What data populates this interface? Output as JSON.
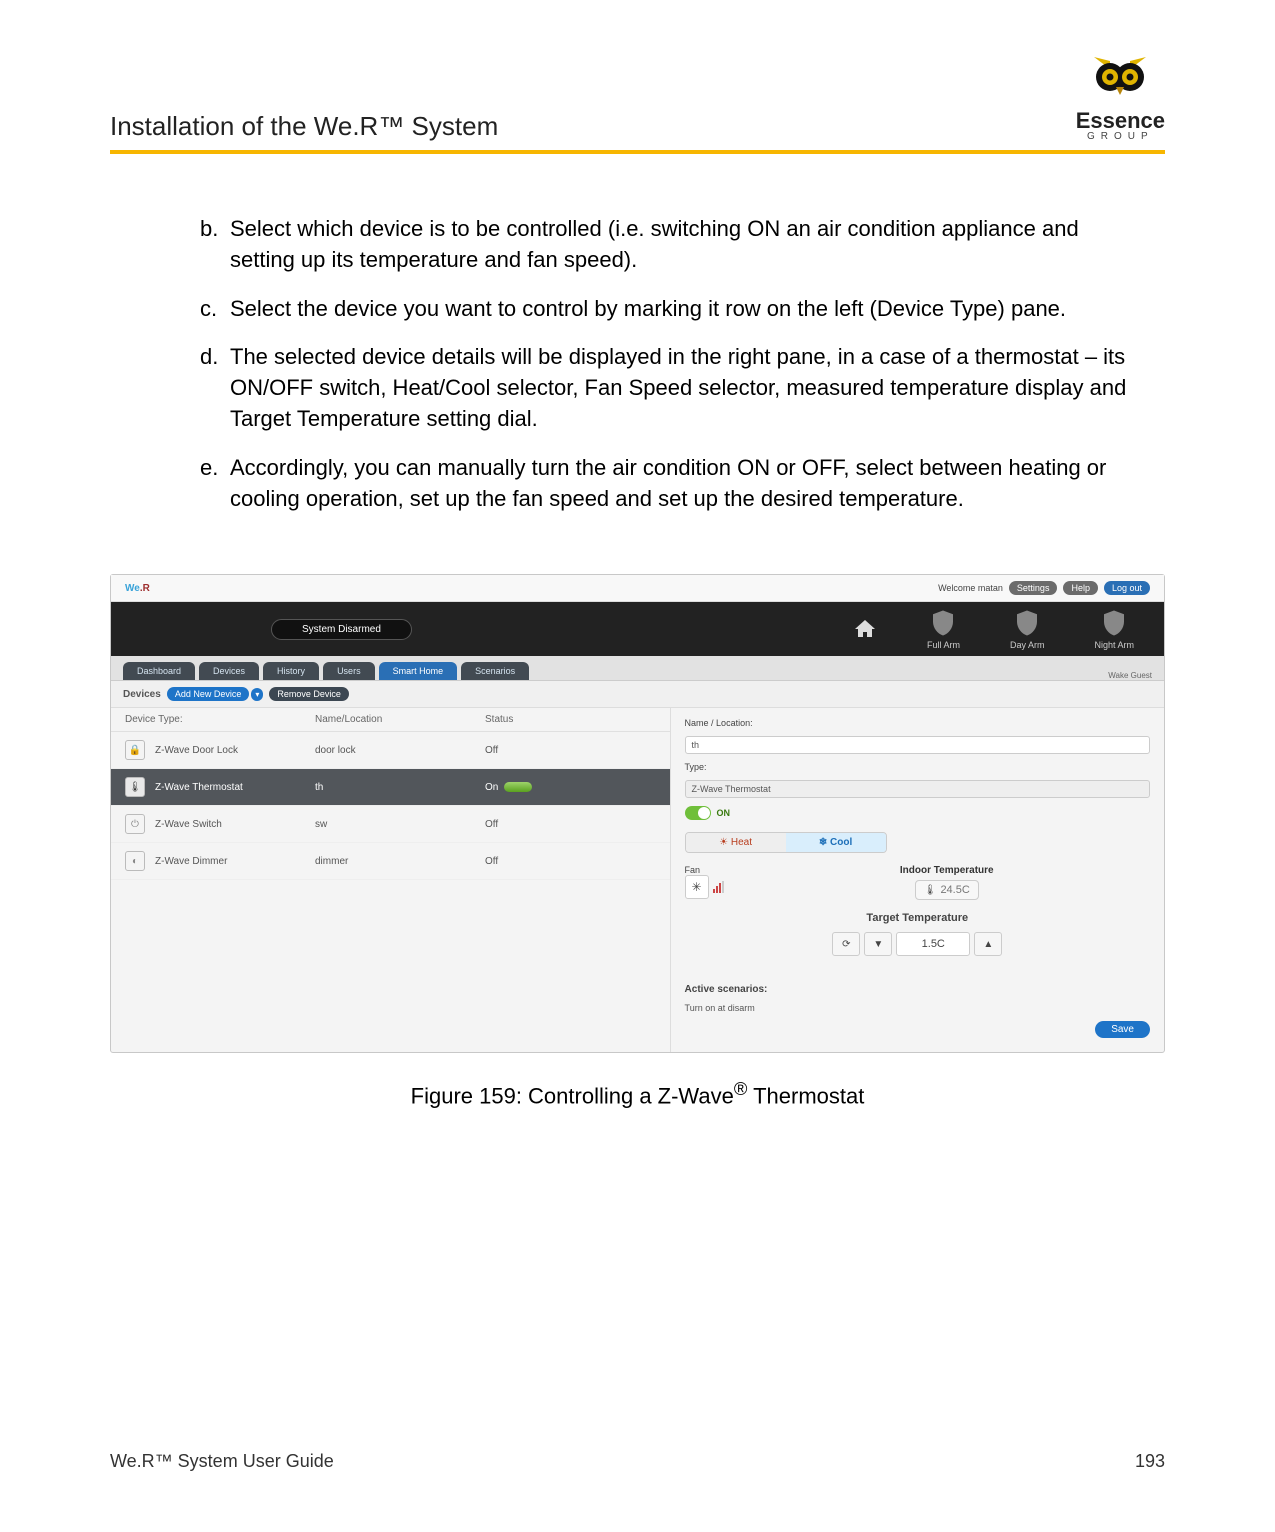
{
  "header": {
    "title": "Installation of the We.R™ System"
  },
  "logo": {
    "name": "Essence",
    "sub": "GROUP"
  },
  "instructions": {
    "b": {
      "marker": "b.",
      "text": "Select which device is to be controlled (i.e. switching ON an air condition appliance and setting up its temperature and fan speed)."
    },
    "c": {
      "marker": "c.",
      "text": "Select the device you want to control by marking it row on the left (Device Type) pane."
    },
    "d": {
      "marker": "d.",
      "text": "The selected device details will be displayed in the right pane, in a case of a thermostat – its ON/OFF switch, Heat/Cool selector, Fan Speed selector, measured temperature display and Target Temperature setting dial."
    },
    "e": {
      "marker": "e.",
      "text": "Accordingly, you can manually turn the air condition ON or OFF, select between heating or cooling operation, set up the fan speed and set up the desired temperature."
    }
  },
  "app": {
    "brand": {
      "w": "We",
      "r": ".R"
    },
    "welcome": "Welcome matan",
    "top_buttons": {
      "settings": "Settings",
      "help": "Help",
      "logout": "Log out"
    },
    "arm": {
      "status": "System Disarmed",
      "full": "Full Arm",
      "day": "Day Arm",
      "night": "Night Arm"
    },
    "tabs": {
      "dashboard": "Dashboard",
      "devices": "Devices",
      "history": "History",
      "users": "Users",
      "smart": "Smart Home",
      "scenarios": "Scenarios"
    },
    "wake": "Wake Guest",
    "subbar": {
      "devices": "Devices",
      "add": "Add New Device",
      "remove": "Remove Device"
    },
    "cols": {
      "type": "Device Type:",
      "name": "Name/Location",
      "status": "Status"
    },
    "rows": {
      "r0": {
        "name": "Z-Wave Door Lock",
        "loc": "door lock",
        "status": "Off"
      },
      "r1": {
        "name": "Z-Wave Thermostat",
        "loc": "th",
        "status": "On"
      },
      "r2": {
        "name": "Z-Wave Switch",
        "loc": "sw",
        "status": "Off"
      },
      "r3": {
        "name": "Z-Wave Dimmer",
        "loc": "dimmer",
        "status": "Off"
      }
    },
    "detail": {
      "name_lbl": "Name / Location:",
      "name_val": "th",
      "type_lbl": "Type:",
      "type_val": "Z-Wave Thermostat",
      "on": "ON",
      "heat": "Heat",
      "cool": "Cool",
      "fan_lbl": "Fan",
      "indoor_lbl": "Indoor Temperature",
      "indoor_val": "24.5C",
      "target_lbl": "Target Temperature",
      "target_val": "1.5C",
      "scen_lbl": "Active scenarios:",
      "scen_val": "Turn on at disarm",
      "save": "Save"
    }
  },
  "caption": {
    "pre": "Figure 159: Controlling a Z-Wave",
    "suf": " Thermostat"
  },
  "footer": {
    "left": "We.R™ System User Guide",
    "right": "193"
  }
}
